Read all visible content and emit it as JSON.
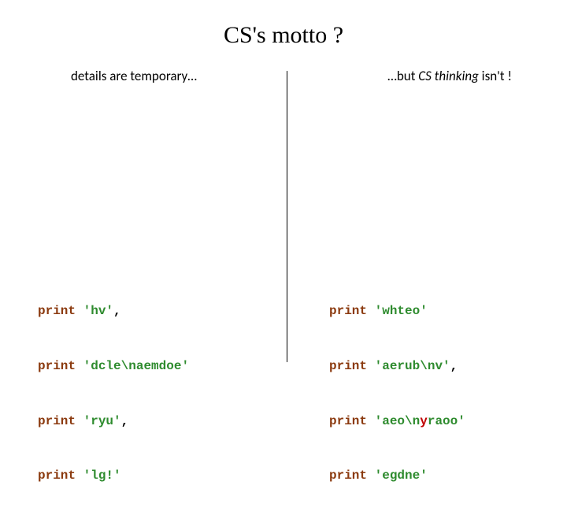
{
  "title": "CS's motto ?",
  "subtitles": {
    "left": "details are temporary…",
    "right_prefix": "…but ",
    "right_italic": "CS thinking",
    "right_suffix": " isn't !"
  },
  "code": {
    "left": [
      {
        "kw": "print",
        "str": "'hv'",
        "trail": ","
      },
      {
        "kw": "print",
        "str": "'dcle\\naemdoe'",
        "trail": ""
      },
      {
        "kw": "print",
        "str": "'ryu'",
        "trail": ","
      },
      {
        "kw": "print",
        "str": "'lg!'",
        "trail": ""
      }
    ],
    "right": [
      {
        "kw": "print",
        "str": "'whteo'",
        "trail": ""
      },
      {
        "kw": "print",
        "str": "'aerub\\nv'",
        "trail": ","
      },
      {
        "kw": "print",
        "str_a": "'aeo\\n",
        "err": "y",
        "str_b": "raoo'",
        "trail": ""
      },
      {
        "kw": "print",
        "str": "'egdne'",
        "trail": ""
      }
    ]
  }
}
